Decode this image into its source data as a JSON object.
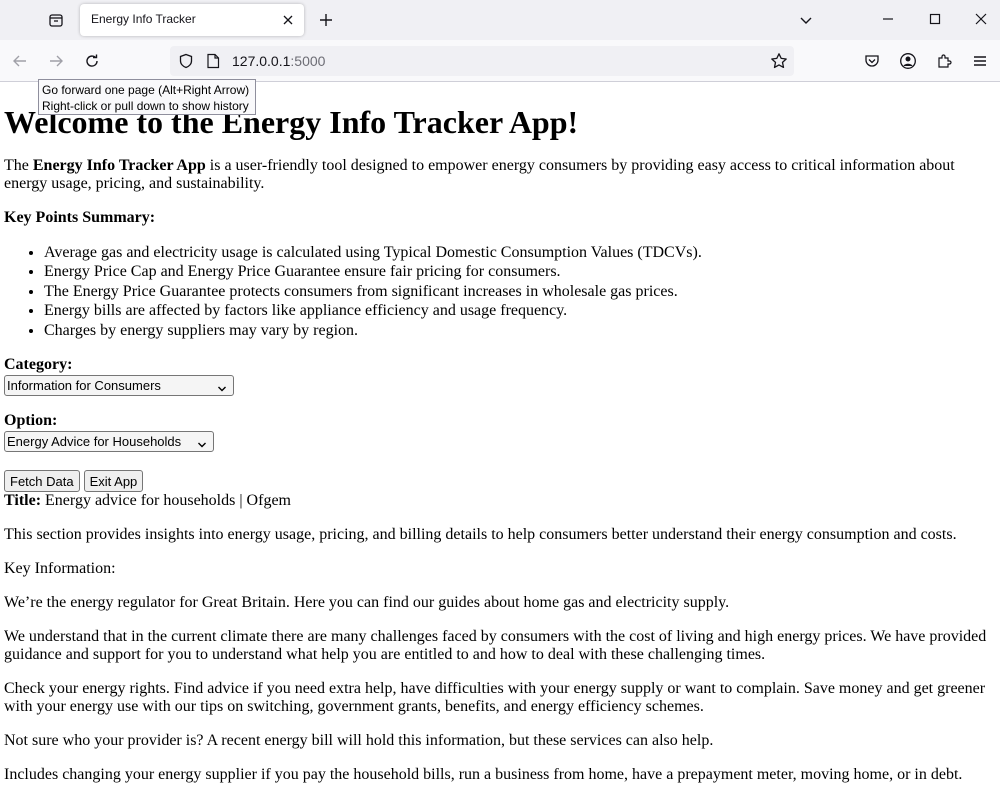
{
  "browser": {
    "tab_title": "Energy Info Tracker",
    "url_host": "127.0.0.1",
    "url_port": ":5000",
    "tooltip_line1": "Go forward one page (Alt+Right Arrow)",
    "tooltip_line2": "Right-click or pull down to show history"
  },
  "page": {
    "heading": "Welcome to the Energy Info Tracker App!",
    "intro_bold": "Energy Info Tracker App",
    "intro_pre": "The ",
    "intro_post": " is a user-friendly tool designed to empower energy consumers by providing easy access to critical information about energy usage, pricing, and sustainability.",
    "summary_heading": "Key Points Summary:",
    "key_points": [
      "Average gas and electricity usage is calculated using Typical Domestic Consumption Values (TDCVs).",
      "Energy Price Cap and Energy Price Guarantee ensure fair pricing for consumers.",
      "The Energy Price Guarantee protects consumers from significant increases in wholesale gas prices.",
      "Energy bills are affected by factors like appliance efficiency and usage frequency.",
      "Charges by energy suppliers may vary by region."
    ],
    "category_label": "Category:",
    "category_value": "Information for Consumers",
    "option_label": "Option:",
    "option_value": "Energy Advice for Households",
    "fetch_button": "Fetch Data",
    "exit_button": "Exit App",
    "result_title_label": "Title:",
    "result_title_value": " Energy advice for households | Ofgem",
    "result_paragraphs": [
      "This section provides insights into energy usage, pricing, and billing details to help consumers better understand their energy consumption and costs.",
      "Key Information:",
      "We’re the energy regulator for Great Britain. Here you can find our guides about home gas and electricity supply.",
      "We understand that in the current climate there are many challenges faced by consumers with the cost of living and high energy prices. We have provided guidance and support for you to understand what help you are entitled to and how to deal with these challenging times.",
      "Check your energy rights. Find advice if you need extra help, have difficulties with your energy supply or want to complain. Save money and get greener with your energy use with our tips on switching, government grants, benefits, and energy efficiency schemes.",
      "Not sure who your provider is? A recent energy bill will hold this information, but these services can also help.",
      "Includes changing your energy supplier if you pay the household bills, run a business from home, have a prepayment meter, moving home, or in debt."
    ]
  }
}
